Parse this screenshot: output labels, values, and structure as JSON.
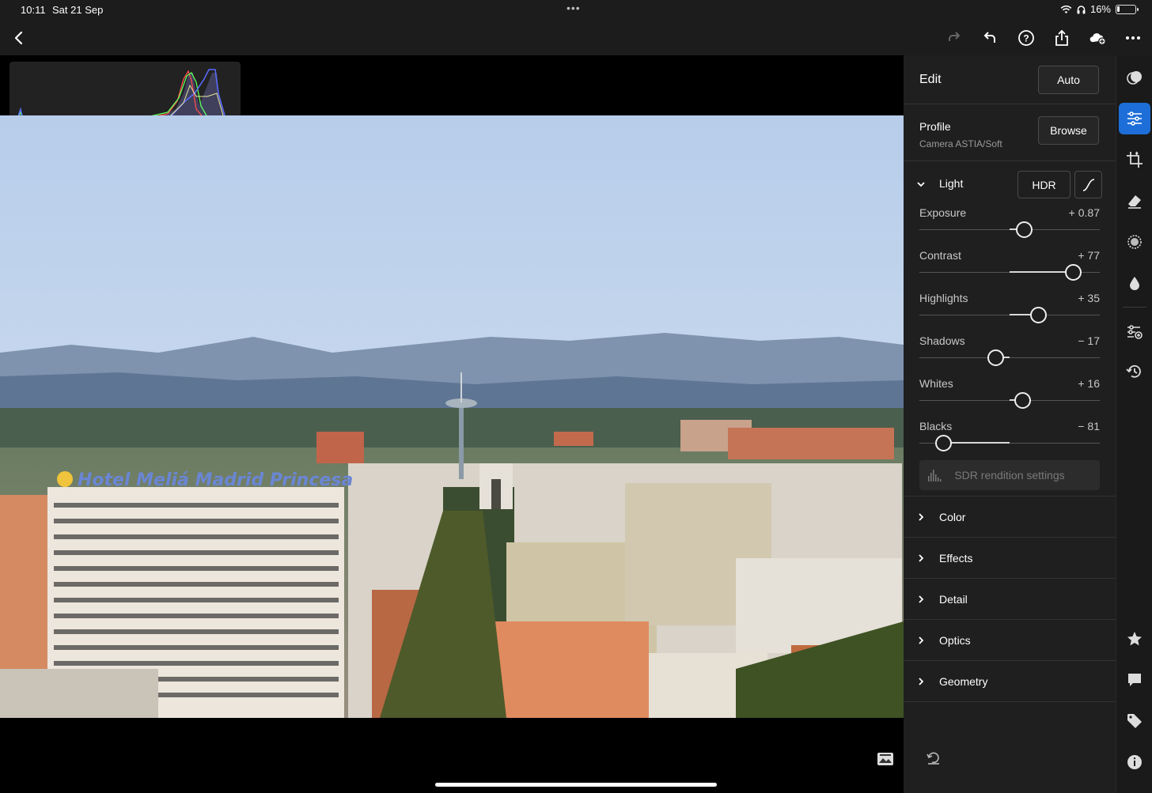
{
  "status": {
    "time": "10:11",
    "date": "Sat 21 Sep",
    "battery": "16%",
    "battery_level": 0.16
  },
  "toolbar": {
    "icons": [
      "back-icon",
      "redo-icon",
      "undo-icon",
      "help-icon",
      "share-icon",
      "cloud-add-icon",
      "more-icon"
    ]
  },
  "photo": {
    "sign_text": "Hotel Meliá Madrid Princesa"
  },
  "edit": {
    "title": "Edit",
    "auto_label": "Auto",
    "profile_label": "Profile",
    "profile_value": "Camera ASTIA/Soft",
    "browse_label": "Browse",
    "light": {
      "title": "Light",
      "hdr_label": "HDR",
      "sliders": [
        {
          "name": "Exposure",
          "value": "+ 0.87",
          "position": 0.58
        },
        {
          "name": "Contrast",
          "value": "+ 77",
          "position": 0.85
        },
        {
          "name": "Highlights",
          "value": "+ 35",
          "position": 0.66
        },
        {
          "name": "Shadows",
          "value": "− 17",
          "position": 0.42
        },
        {
          "name": "Whites",
          "value": "+ 16",
          "position": 0.57
        },
        {
          "name": "Blacks",
          "value": "− 81",
          "position": 0.13
        }
      ],
      "sdr_label": "SDR rendition settings"
    },
    "sections": [
      "Color",
      "Effects",
      "Detail",
      "Optics",
      "Geometry"
    ]
  },
  "colors": {
    "accent": "#1d6ed8",
    "panel": "#1f1f1f",
    "rail": "#1a1a1a"
  }
}
